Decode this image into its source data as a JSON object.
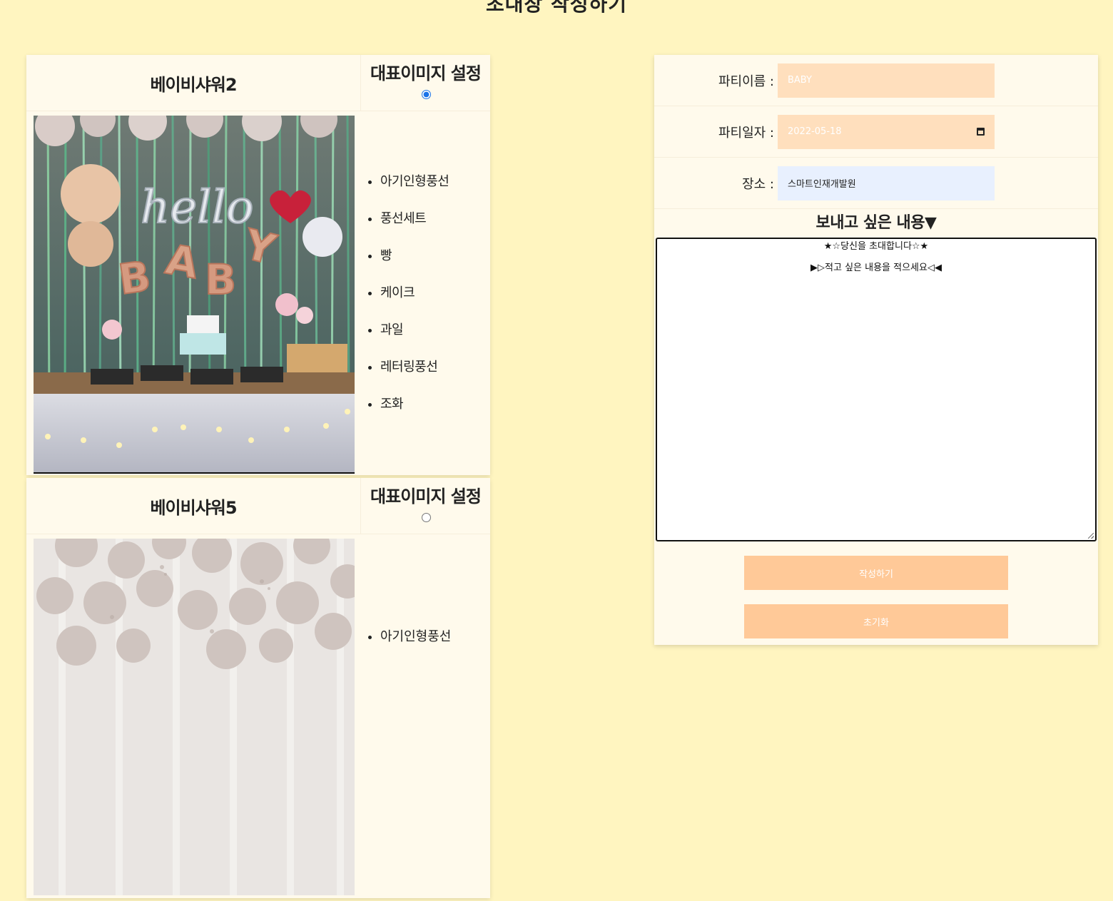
{
  "page": {
    "title": "초대장 작성하기"
  },
  "parties": [
    {
      "name": "베이비샤워2",
      "rep_label": "대표이미지 설정",
      "rep_selected": true,
      "photo_text": "hello BABY",
      "items": [
        "아기인형풍선",
        "풍선세트",
        "빵",
        "케이크",
        "과일",
        "레터링풍선",
        "조화"
      ]
    },
    {
      "name": "베이비샤워5",
      "rep_label": "대표이미지 설정",
      "rep_selected": false,
      "items": [
        "아기인형풍선"
      ]
    }
  ],
  "form": {
    "party_name_label": "파티이름 :",
    "party_name_value": "BABY",
    "party_date_label": "파티일자 :",
    "party_date_value": "2022-05-18",
    "place_label": "장소 :",
    "place_value": "스마트인재개발원",
    "content_title": "보내고 싶은 내용▼",
    "content_line1": "★☆당신을 초대합니다☆★",
    "content_line2": "▶▷적고 싶은 내용을 적으세요◁◀",
    "submit_label": "작성하기",
    "reset_label": "초기화"
  },
  "colors": {
    "background": "#fff5c0",
    "card": "#fffaec",
    "input": "#ffdfbd",
    "button": "#ffc998",
    "radio_accent": "#1a73e8"
  }
}
